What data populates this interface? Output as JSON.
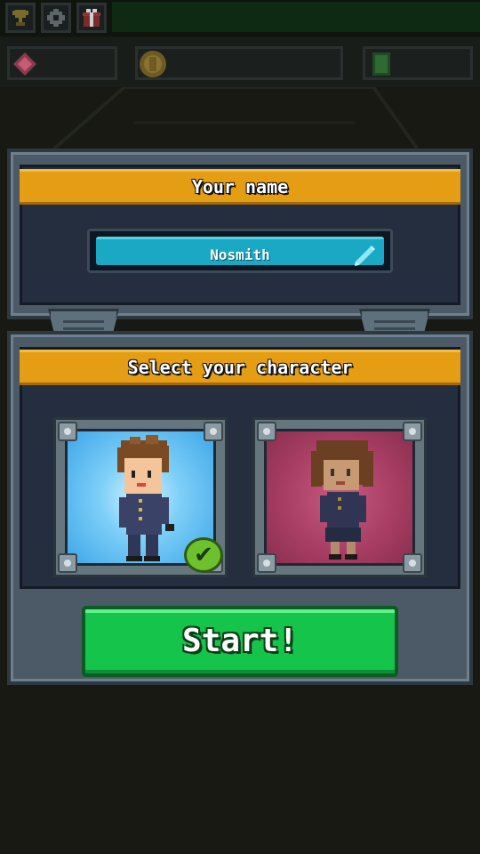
{
  "top_bar": {
    "icons": [
      "trophy-icon",
      "gear-icon",
      "gift-icon"
    ]
  },
  "resources": [
    {
      "icon": "gem-icon",
      "color": "#d65a7a"
    },
    {
      "icon": "coin-icon",
      "color": "#caa23a"
    },
    {
      "icon": "cash-icon",
      "color": "#3f8a3a"
    }
  ],
  "name_panel": {
    "title": "Your name",
    "name_value": "Nosmith",
    "edit_icon": "pencil-icon"
  },
  "character_panel": {
    "title": "Select your character",
    "characters": [
      {
        "id": "male",
        "selected": true,
        "background": "#49b6ef"
      },
      {
        "id": "female",
        "selected": false,
        "background": "#b04568"
      }
    ],
    "selected_icon": "checkmark-icon"
  },
  "start_button": {
    "label": "Start!"
  }
}
